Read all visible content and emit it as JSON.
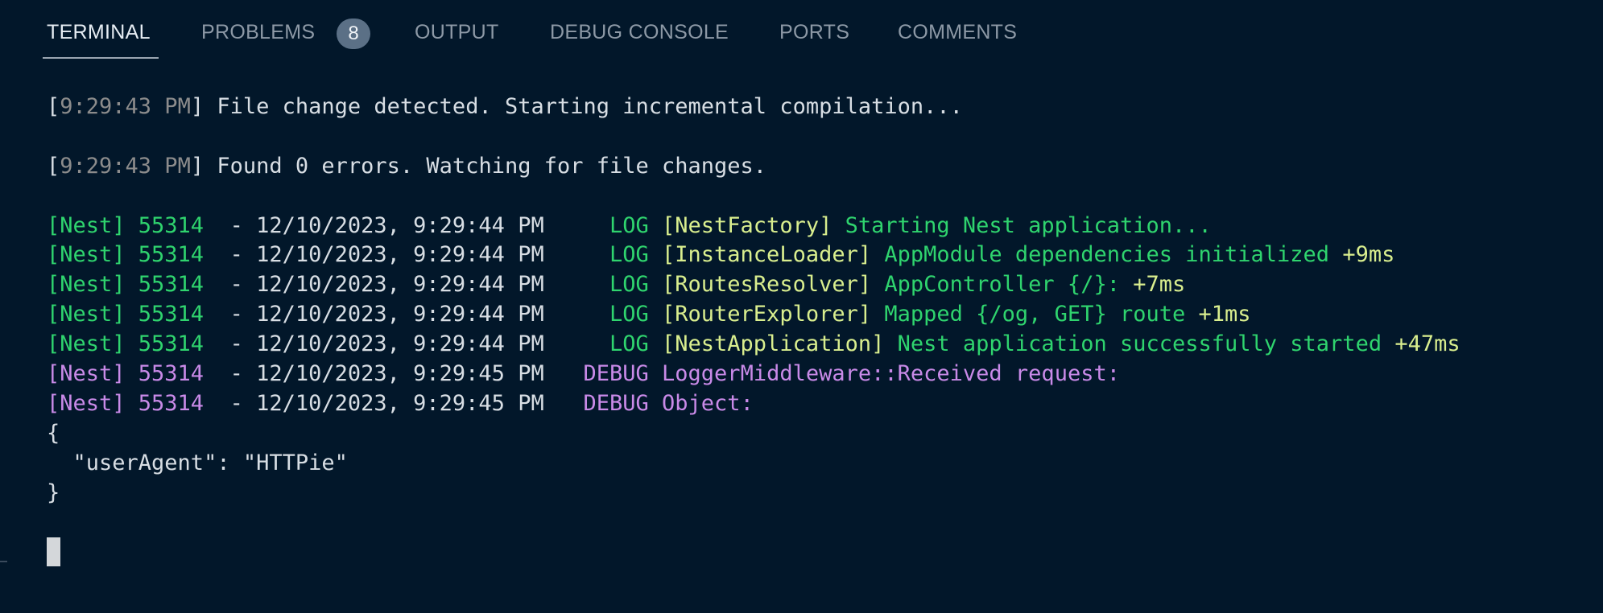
{
  "tabs": [
    {
      "label": "TERMINAL",
      "active": true
    },
    {
      "label": "PROBLEMS",
      "active": false,
      "badge": "8"
    },
    {
      "label": "OUTPUT",
      "active": false
    },
    {
      "label": "DEBUG CONSOLE",
      "active": false
    },
    {
      "label": "PORTS",
      "active": false
    },
    {
      "label": "COMMENTS",
      "active": false
    }
  ],
  "colors": {
    "background": "#02172a",
    "green": "#2fd46e",
    "yellow": "#d9ee8e",
    "purple": "#c98ae8",
    "dim": "#8c8c8c",
    "text": "#d8dee4",
    "badge": "#5b7086"
  },
  "terminal": {
    "lines": [
      {
        "segments": [
          {
            "text": "[",
            "color": "fg"
          },
          {
            "text": "9:29:43 PM",
            "color": "dim"
          },
          {
            "text": "] File change detected. Starting incremental compilation...",
            "color": "fg"
          }
        ]
      },
      {
        "segments": []
      },
      {
        "segments": [
          {
            "text": "[",
            "color": "fg"
          },
          {
            "text": "9:29:43 PM",
            "color": "dim"
          },
          {
            "text": "] Found 0 errors. Watching for file changes.",
            "color": "fg"
          }
        ]
      },
      {
        "segments": []
      },
      {
        "segments": [
          {
            "text": "[Nest] 55314  ",
            "color": "green"
          },
          {
            "text": "- 12/10/2023, 9:29:44 PM     ",
            "color": "fg"
          },
          {
            "text": "LOG ",
            "color": "green"
          },
          {
            "text": "[NestFactory] ",
            "color": "yellow"
          },
          {
            "text": "Starting Nest application...",
            "color": "green"
          }
        ]
      },
      {
        "segments": [
          {
            "text": "[Nest] 55314  ",
            "color": "green"
          },
          {
            "text": "- 12/10/2023, 9:29:44 PM     ",
            "color": "fg"
          },
          {
            "text": "LOG ",
            "color": "green"
          },
          {
            "text": "[InstanceLoader] ",
            "color": "yellow"
          },
          {
            "text": "AppModule dependencies initialized ",
            "color": "green"
          },
          {
            "text": "+9ms",
            "color": "yellow"
          }
        ]
      },
      {
        "segments": [
          {
            "text": "[Nest] 55314  ",
            "color": "green"
          },
          {
            "text": "- 12/10/2023, 9:29:44 PM     ",
            "color": "fg"
          },
          {
            "text": "LOG ",
            "color": "green"
          },
          {
            "text": "[RoutesResolver] ",
            "color": "yellow"
          },
          {
            "text": "AppController {/}: ",
            "color": "green"
          },
          {
            "text": "+7ms",
            "color": "yellow"
          }
        ]
      },
      {
        "segments": [
          {
            "text": "[Nest] 55314  ",
            "color": "green"
          },
          {
            "text": "- 12/10/2023, 9:29:44 PM     ",
            "color": "fg"
          },
          {
            "text": "LOG ",
            "color": "green"
          },
          {
            "text": "[RouterExplorer] ",
            "color": "yellow"
          },
          {
            "text": "Mapped {/og, GET} route ",
            "color": "green"
          },
          {
            "text": "+1ms",
            "color": "yellow"
          }
        ]
      },
      {
        "segments": [
          {
            "text": "[Nest] 55314  ",
            "color": "green"
          },
          {
            "text": "- 12/10/2023, 9:29:44 PM     ",
            "color": "fg"
          },
          {
            "text": "LOG ",
            "color": "green"
          },
          {
            "text": "[NestApplication] ",
            "color": "yellow"
          },
          {
            "text": "Nest application successfully started ",
            "color": "green"
          },
          {
            "text": "+47ms",
            "color": "yellow"
          }
        ]
      },
      {
        "segments": [
          {
            "text": "[Nest] 55314  ",
            "color": "purple"
          },
          {
            "text": "- 12/10/2023, 9:29:45 PM   ",
            "color": "fg"
          },
          {
            "text": "DEBUG ",
            "color": "purple"
          },
          {
            "text": "LoggerMiddleware::Received request:",
            "color": "purple"
          }
        ]
      },
      {
        "segments": [
          {
            "text": "[Nest] 55314  ",
            "color": "purple"
          },
          {
            "text": "- 12/10/2023, 9:29:45 PM   ",
            "color": "fg"
          },
          {
            "text": "DEBUG ",
            "color": "purple"
          },
          {
            "text": "Object:",
            "color": "purple"
          }
        ]
      },
      {
        "segments": [
          {
            "text": "{",
            "color": "fg"
          }
        ]
      },
      {
        "segments": [
          {
            "text": "  \"userAgent\": \"HTTPie\"",
            "color": "fg"
          }
        ]
      },
      {
        "segments": [
          {
            "text": "}",
            "color": "fg"
          }
        ]
      }
    ]
  }
}
